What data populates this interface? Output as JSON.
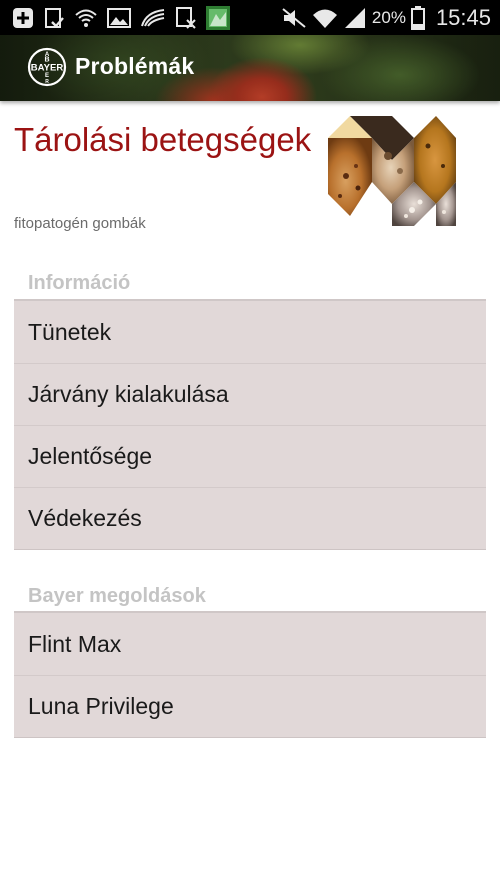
{
  "status_bar": {
    "icons_left": [
      "add-box-icon",
      "clipboard-check-icon",
      "wifi-question-icon",
      "image-icon",
      "signal-swoosh-icon",
      "sim-off-icon",
      "app-thumbnail-icon"
    ],
    "icons_right": [
      "mute-icon",
      "wifi-icon",
      "cell-signal-icon",
      "battery-icon"
    ],
    "battery": "20%",
    "time": "15:45"
  },
  "action_bar": {
    "logo_text": "BAYER",
    "title": "Problémák"
  },
  "header": {
    "title": "Tárolási betegségek",
    "subtitle": "fitopatogén gombák"
  },
  "sections": [
    {
      "header": "Információ",
      "items": [
        "Tünetek",
        "Járvány kialakulása",
        "Jelentősége",
        "Védekezés"
      ]
    },
    {
      "header": "Bayer megoldások",
      "items": [
        "Flint Max",
        "Luna Privilege"
      ]
    }
  ],
  "colors": {
    "title_red": "#9b1313",
    "section_gray": "#c4c4c4",
    "list_bg": "#e1d8d8"
  }
}
